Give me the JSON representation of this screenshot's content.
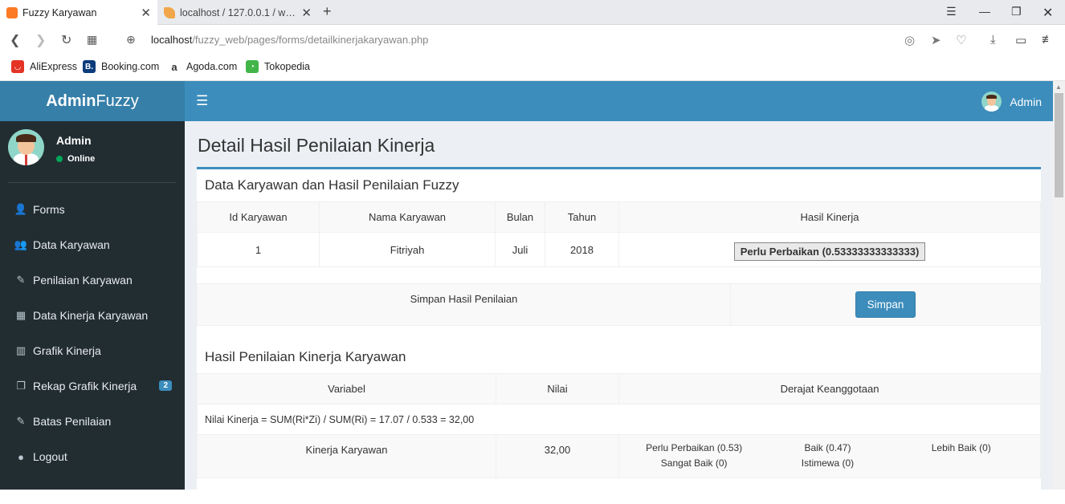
{
  "browser": {
    "tabs": [
      {
        "title": "Fuzzy Karyawan",
        "active": true
      },
      {
        "title": "localhost / 127.0.0.1 / web_",
        "active": false
      }
    ],
    "url_host": "localhost",
    "url_path": "/fuzzy_web/pages/forms/detailkinerjakaryawan.php",
    "bookmarks": [
      "AliExpress",
      "Booking.com",
      "Agoda.com",
      "Tokopedia"
    ]
  },
  "app": {
    "logo_bold": "Admin",
    "logo_rest": "Fuzzy",
    "top_user": "Admin",
    "sidebar_user": "Admin",
    "sidebar_status": "Online",
    "menu": [
      {
        "label": "Forms",
        "icon": "user-plus-icon"
      },
      {
        "label": "Data Karyawan",
        "icon": "users-icon"
      },
      {
        "label": "Penilaian Karyawan",
        "icon": "edit-icon"
      },
      {
        "label": "Data Kinerja Karyawan",
        "icon": "qrcode-icon"
      },
      {
        "label": "Grafik Kinerja",
        "icon": "bar-chart-icon"
      },
      {
        "label": "Rekap Grafik Kinerja",
        "icon": "copy-icon",
        "badge": "2"
      },
      {
        "label": "Batas Penilaian",
        "icon": "edit-icon"
      },
      {
        "label": "Logout",
        "icon": "user-icon"
      }
    ]
  },
  "page": {
    "title": "Detail Hasil Penilaian Kinerja",
    "section1_title": "Data Karyawan dan Hasil Penilaian Fuzzy",
    "table1": {
      "headers": [
        "Id Karyawan",
        "Nama Karyawan",
        "Bulan",
        "Tahun",
        "Hasil Kinerja"
      ],
      "row": {
        "id": "1",
        "nama": "Fitriyah",
        "bulan": "Juli",
        "tahun": "2018",
        "hasil": "Perlu Perbaikan (0.53333333333333)"
      }
    },
    "simpan_label": "Simpan Hasil Penilaian",
    "simpan_button": "Simpan",
    "section2_title": "Hasil Penilaian Kinerja Karyawan",
    "table2": {
      "headers": [
        "Variabel",
        "Nilai",
        "Derajat Keanggotaan"
      ],
      "formula": "Nilai Kinerja = SUM(Ri*Zi) / SUM(Ri) = 17.07 / 0.533 = 32,00",
      "variable": "Kinerja Karyawan",
      "nilai": "32,00",
      "degrees": [
        "Perlu Perbaikan (0.53)",
        "Baik (0.47)",
        "Lebih Baik (0)",
        "Sangat Baik (0)",
        "Istimewa (0)"
      ]
    }
  },
  "colors": {
    "primary": "#3c8dbc",
    "logo_bg": "#367fa9",
    "sidebar_bg": "#222d32",
    "content_bg": "#ecf0f5"
  }
}
